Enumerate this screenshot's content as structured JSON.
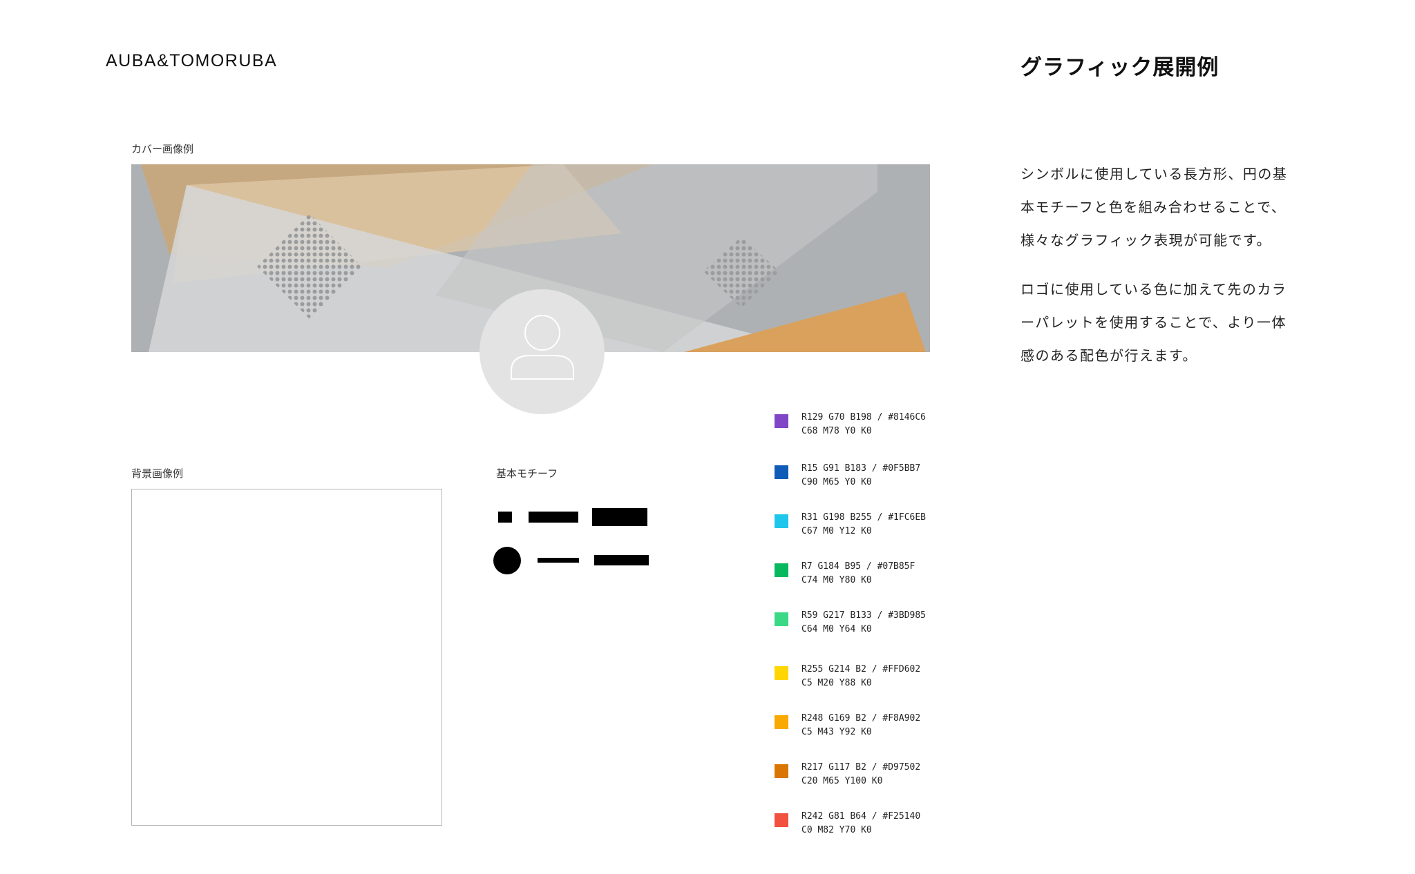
{
  "brand": "AUBA&TOMORUBA",
  "title": "グラフィック展開例",
  "labels": {
    "cover": "カバー画像例",
    "background": "背景画像例",
    "motif": "基本モチーフ"
  },
  "description": {
    "paragraph1": "シンボルに使用している長方形、円の基本モチーフと色を組み合わせることで、様々なグラフィック表現が可能です。",
    "paragraph2": "ロゴに使用している色に加えて先のカラーパレットを使用することで、より一体感のある配色が行えます。"
  },
  "avatar_icon": "user-icon",
  "cover_colors": {
    "base": "#aeb1b3",
    "tan": "#c9a77a",
    "light_tan": "#e0c9a8",
    "orange": "#d9a15c",
    "light_gray": "#d6d7d7"
  },
  "palette": [
    {
      "color": "#8146C6",
      "rgb": "R129 G70 B198 / #8146C6",
      "cmyk": "C68 M78 Y0 K0"
    },
    {
      "color": "#0F5BB7",
      "rgb": "R15 G91 B183 / #0F5BB7",
      "cmyk": "C90 M65 Y0 K0"
    },
    {
      "color": "#1FC6EB",
      "rgb": "R31 G198 B255 / #1FC6EB",
      "cmyk": "C67 M0 Y12 K0"
    },
    {
      "color": "#07B85F",
      "rgb": "R7 G184 B95 / #07B85F",
      "cmyk": "C74 M0 Y80 K0"
    },
    {
      "color": "#3BD985",
      "rgb": "R59 G217 B133 / #3BD985",
      "cmyk": "C64 M0 Y64 K0"
    },
    {
      "color": "#FFD602",
      "rgb": "R255 G214 B2 / #FFD602",
      "cmyk": "C5 M20 Y88 K0"
    },
    {
      "color": "#F8A902",
      "rgb": "R248 G169 B2 / #F8A902",
      "cmyk": "C5 M43 Y92 K0"
    },
    {
      "color": "#D97502",
      "rgb": "R217 G117 B2 / #D97502",
      "cmyk": "C20 M65 Y100 K0"
    },
    {
      "color": "#F25140",
      "rgb": "R242 G81 B64 / #F25140",
      "cmyk": "C0 M82 Y70 K0"
    }
  ]
}
